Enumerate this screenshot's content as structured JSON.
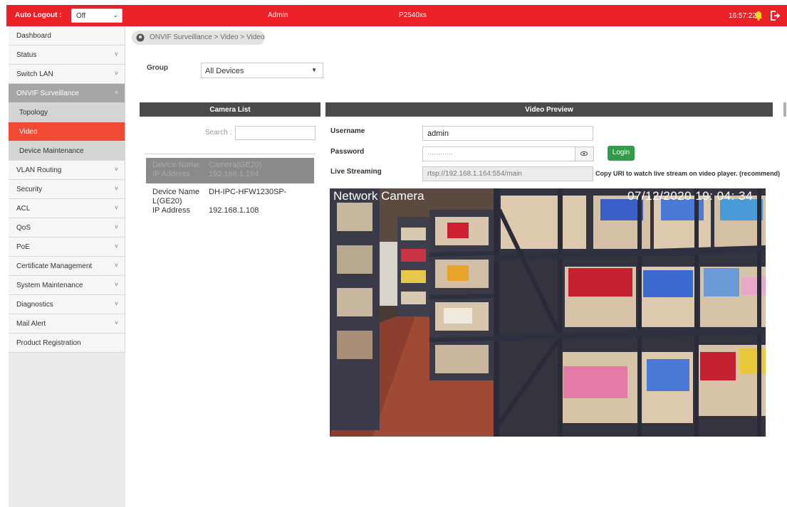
{
  "topbar": {
    "auto_logout_label": "Auto Logout :",
    "auto_logout_value": "Off",
    "user": "Admin",
    "model": "P2540xs",
    "time": "16:57:22"
  },
  "sidebar": {
    "items": [
      {
        "label": "Dashboard"
      },
      {
        "label": "Status"
      },
      {
        "label": "Switch LAN"
      },
      {
        "label": "ONVIF Surveillance"
      },
      {
        "label": "Topology"
      },
      {
        "label": "Video"
      },
      {
        "label": "Device Maintenance"
      },
      {
        "label": "VLAN Routing"
      },
      {
        "label": "Security"
      },
      {
        "label": "ACL"
      },
      {
        "label": "QoS"
      },
      {
        "label": "PoE"
      },
      {
        "label": "Certificate Management"
      },
      {
        "label": "System Maintenance"
      },
      {
        "label": "Diagnostics"
      },
      {
        "label": "Mail Alert"
      },
      {
        "label": "Product Registration"
      }
    ]
  },
  "breadcrumb": "ONVIF Surveillance > Video > Video",
  "group": {
    "label": "Group",
    "value": "All Devices"
  },
  "camera_list": {
    "title": "Camera List",
    "search_label": "Search :",
    "search_value": "",
    "device_name_key": "Device Name",
    "ip_key": "IP Address",
    "cameras": [
      {
        "name": "Camera(GE20)",
        "ip": "192.168.1.164"
      },
      {
        "name": "DH-IPC-HFW1230SP-L(GE20)",
        "ip": "192.168.1.108"
      }
    ]
  },
  "preview": {
    "title": "Video Preview",
    "username_label": "Username",
    "username_value": "admin",
    "password_label": "Password",
    "password_value": "············",
    "login_label": "Login",
    "live_label": "Live Streaming",
    "live_value": "rtsp://192.168.1.164:554/main",
    "copy_note": "Copy URI to watch live stream on video player. (recommend)",
    "osd_title": "Network Camera",
    "osd_time": "07/12/2020  19: 04: 34"
  },
  "colors": {
    "brand_red": "#ec2127",
    "active_item": "#f04a34",
    "login_green": "#2f9c47",
    "panel_header": "#4a4a4a"
  },
  "icons": {
    "bell": "bell-icon",
    "logout": "logout-icon",
    "breadcrumb": "location-icon",
    "eye": "eye-icon",
    "chevron": "chevron-down-icon"
  }
}
